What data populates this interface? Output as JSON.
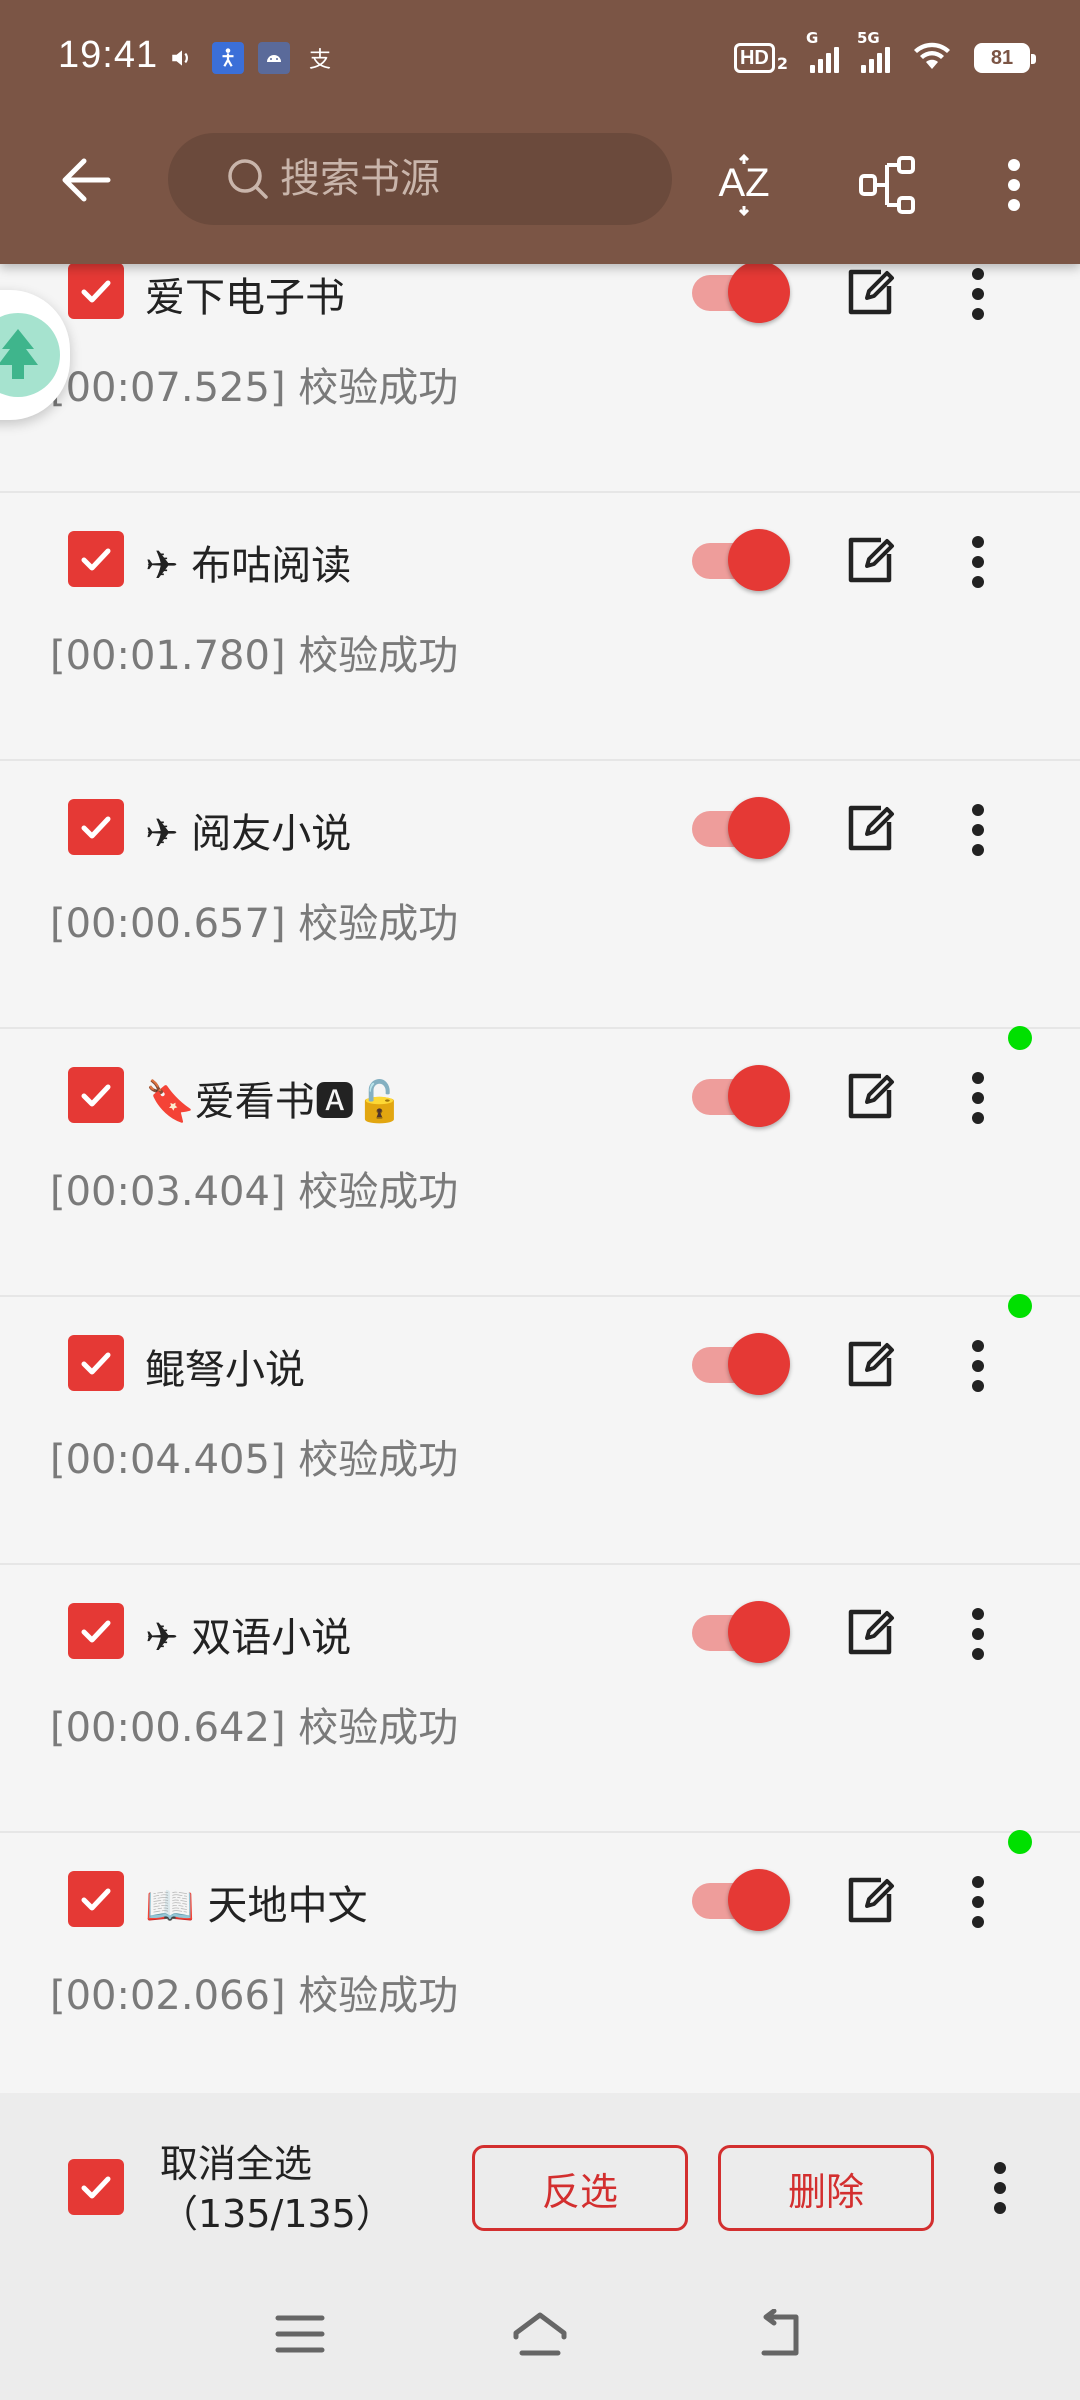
{
  "status_bar": {
    "time": "19:41",
    "left_icons": [
      "volume-icon",
      "accessibility-icon",
      "android-icon",
      "input-method-icon"
    ],
    "input_method_glyph": "支",
    "hd_badge": "HD",
    "hd_sub": "2",
    "signal1_label": "G",
    "signal2_label": "5G",
    "battery": "81"
  },
  "toolbar": {
    "search_placeholder": "搜索书源",
    "sort_label": "AZ"
  },
  "sources": [
    {
      "name": "爱下电子书",
      "status": "[00:07.525] 校验成功",
      "checked": true,
      "enabled": true,
      "dot": true
    },
    {
      "name": "✈ 布咕阅读",
      "status": "[00:01.780] 校验成功",
      "checked": true,
      "enabled": true,
      "dot": false
    },
    {
      "name": "✈ 阅友小说",
      "status": "[00:00.657] 校验成功",
      "checked": true,
      "enabled": true,
      "dot": false
    },
    {
      "name": "🔖爱看书🅰🔓",
      "status": "[00:03.404] 校验成功",
      "checked": true,
      "enabled": true,
      "dot": true
    },
    {
      "name": "鲲弩小说",
      "status": "[00:04.405] 校验成功",
      "checked": true,
      "enabled": true,
      "dot": true
    },
    {
      "name": "✈ 双语小说",
      "status": "[00:00.642] 校验成功",
      "checked": true,
      "enabled": true,
      "dot": false
    },
    {
      "name": "📖 天地中文",
      "status": "[00:02.066] 校验成功",
      "checked": true,
      "enabled": true,
      "dot": true
    }
  ],
  "action_bar": {
    "select_label": "取消全选",
    "count": "（135/135）",
    "invert_label": "反选",
    "delete_label": "删除"
  },
  "colors": {
    "toolbar": "#7b5545",
    "accent": "#e53935",
    "online_dot": "#00e000"
  }
}
